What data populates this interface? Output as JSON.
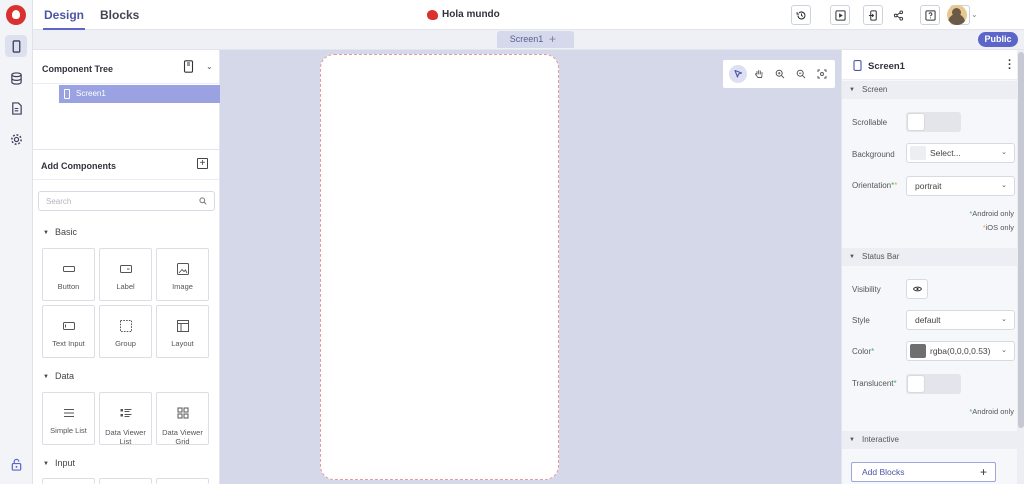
{
  "header": {
    "tabs": [
      "Design",
      "Blocks"
    ],
    "project_name": "Hola mundo"
  },
  "screen_strip": {
    "tab_label": "Screen1",
    "add_symbol": "+",
    "public_label": "Public"
  },
  "component_tree": {
    "title": "Component Tree",
    "items": [
      "Screen1"
    ]
  },
  "add_components": {
    "title": "Add Components",
    "search_placeholder": "Search",
    "categories": [
      {
        "label": "Basic",
        "items": [
          "Button",
          "Label",
          "Image",
          "Text Input",
          "Group",
          "Layout"
        ]
      },
      {
        "label": "Data",
        "items": [
          "Simple List",
          "Data Viewer List",
          "Data Viewer Grid"
        ]
      },
      {
        "label": "Input",
        "items": []
      }
    ]
  },
  "properties": {
    "title": "Screen1",
    "sections": {
      "screen": "Screen",
      "status_bar": "Status Bar",
      "interactive": "Interactive"
    },
    "scrollable_label": "Scrollable",
    "background_label": "Background",
    "background_value": "Select...",
    "orientation_label": "Orientation",
    "orientation_value": "portrait",
    "android_only": "Android only",
    "ios_only": "iOS only",
    "visibility_label": "Visibility",
    "style_label": "Style",
    "style_value": "default",
    "color_label": "Color",
    "color_value": "rgba(0,0,0,0.53)",
    "translucent_label": "Translucent",
    "android_only_2": "Android only",
    "add_blocks_label": "Add Blocks"
  },
  "colors": {
    "accent": "#5b66c8",
    "brand_red": "#d9312f",
    "selected_tree": "#9aa2e2",
    "canvas_bg": "#d4d8e8",
    "android_marker": "#2fb87a",
    "ios_marker": "#f0a53c",
    "status_color_swatch": "#6f6f6f"
  }
}
